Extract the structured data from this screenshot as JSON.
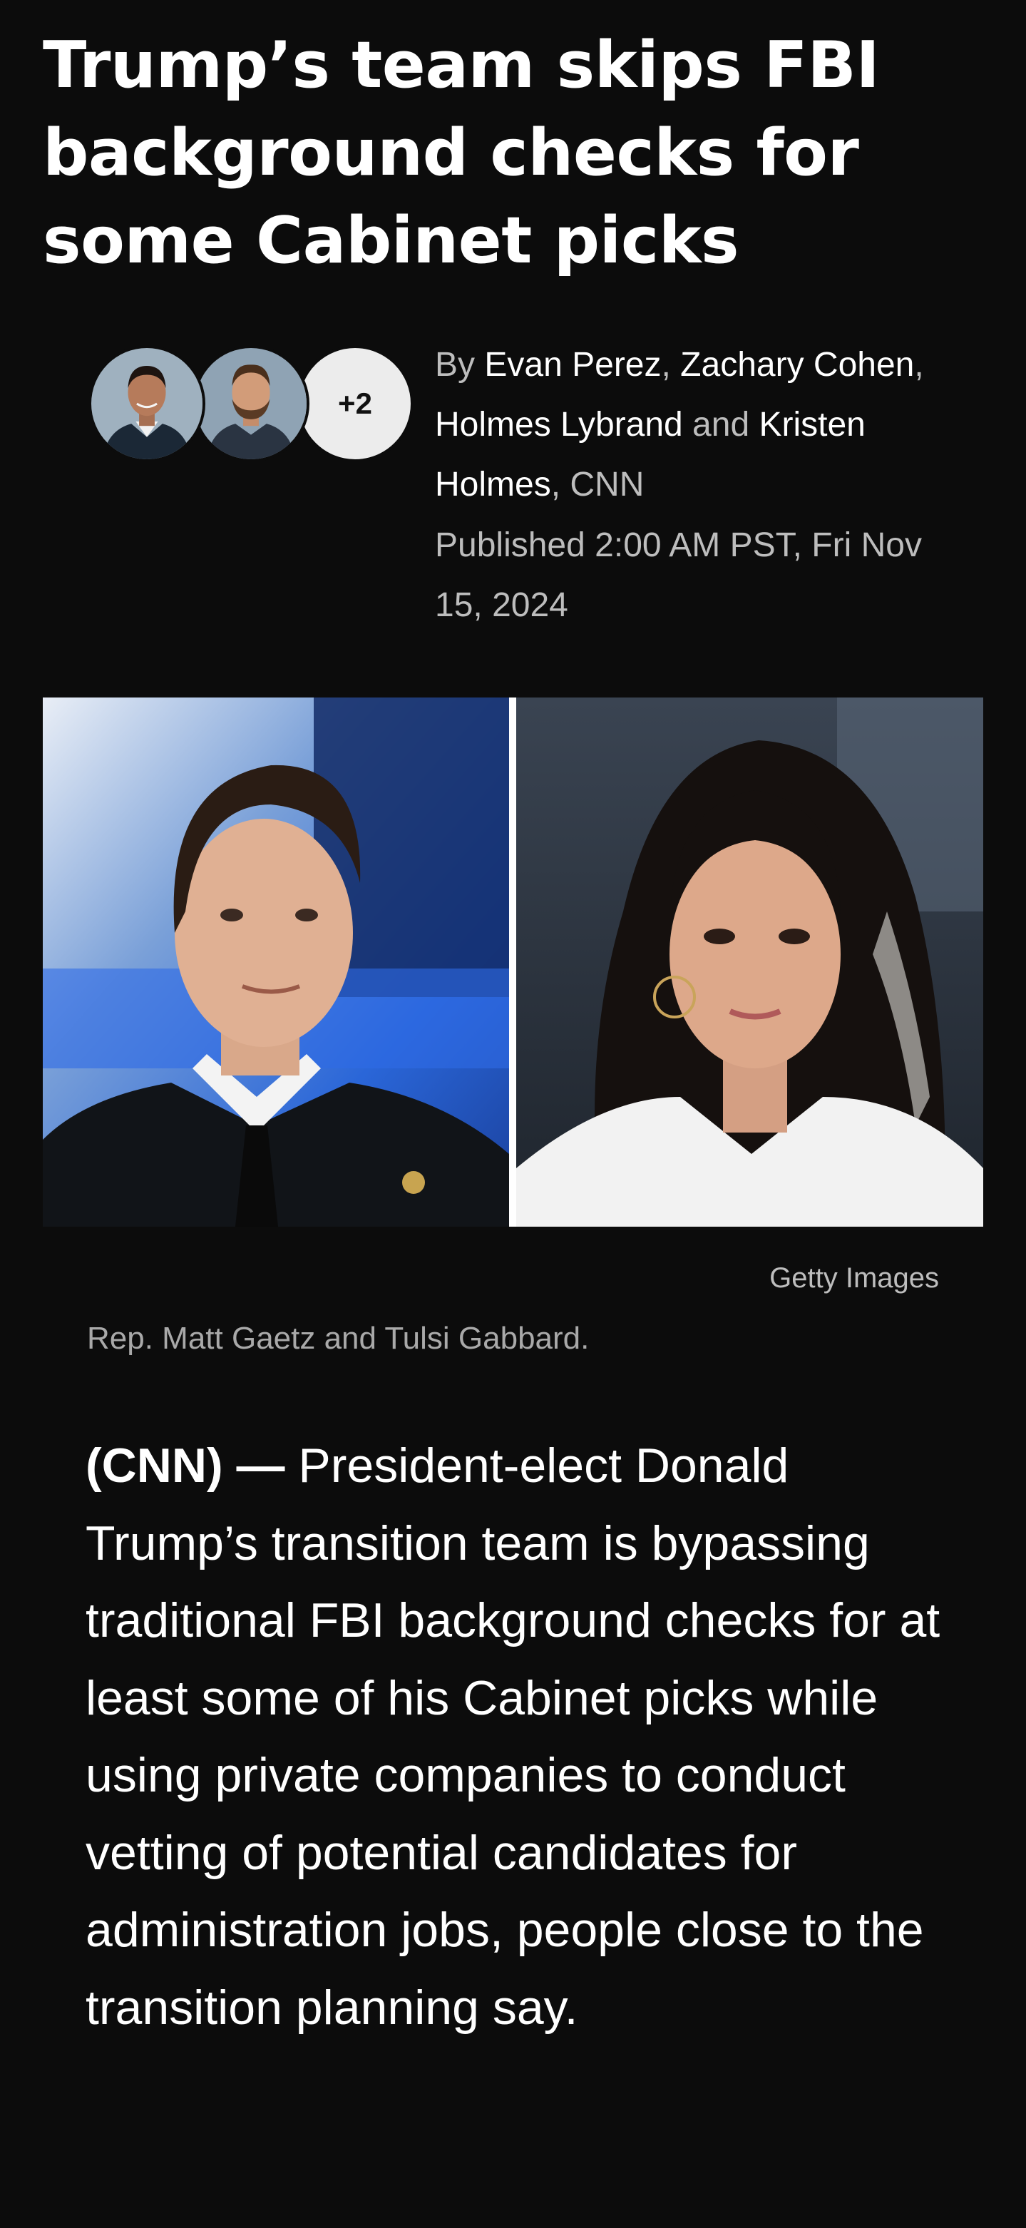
{
  "article": {
    "headline": "Trump’s team skips FBI background checks for some Cabinet picks",
    "byline": {
      "prefix": "By",
      "authors": [
        "Evan Perez",
        "Zachary Cohen",
        "Holmes Lybrand",
        "Kristen Holmes"
      ],
      "sep_comma": ", ",
      "sep_and": " and ",
      "outlet": ", CNN",
      "extra_authors_badge": "+2"
    },
    "published": "Published 2:00 AM PST, Fri Nov 15, 2024",
    "image": {
      "credit": "Getty Images",
      "caption": "Rep. Matt Gaetz and Tulsi Gabbard."
    },
    "body": {
      "dateline": "(CNN) —",
      "text": "President-elect Donald Trump’s transition team is bypassing traditional FBI background checks for at least some of his Cabinet picks while using private companies to conduct vetting of potential candidates for administration jobs, people close to the transition planning say."
    }
  },
  "colors": {
    "background": "#0c0c0c",
    "text_primary": "#ffffff",
    "text_secondary": "#bdbdbd",
    "caption": "#a9a9a9"
  }
}
